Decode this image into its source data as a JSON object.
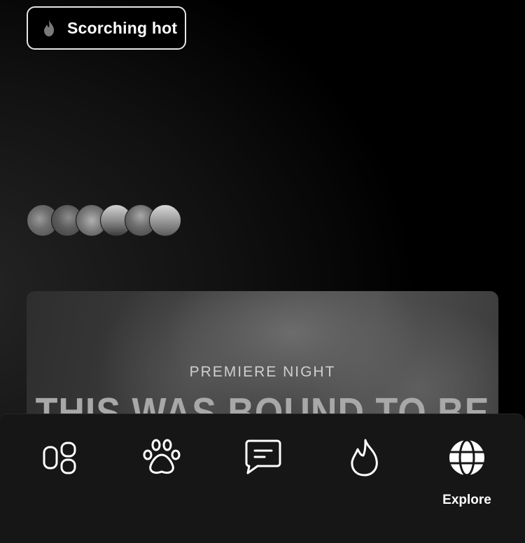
{
  "filter_chip": {
    "label": "Scorching hot",
    "icon": "flame-icon"
  },
  "avatars": [
    {
      "name": "avatar-1"
    },
    {
      "name": "avatar-2"
    },
    {
      "name": "avatar-3"
    },
    {
      "name": "avatar-4"
    },
    {
      "name": "avatar-5"
    },
    {
      "name": "avatar-6"
    }
  ],
  "promo": {
    "kicker": "PREMIERE NIGHT",
    "title": "THIS WAS BOUND TO BE"
  },
  "tabbar": {
    "items": [
      {
        "icon": "grid-icon",
        "label": ""
      },
      {
        "icon": "paw-icon",
        "label": ""
      },
      {
        "icon": "chat-icon",
        "label": ""
      },
      {
        "icon": "flame-icon",
        "label": ""
      },
      {
        "icon": "globe-icon",
        "label": "Explore",
        "active": true
      }
    ]
  },
  "colors": {
    "background": "#000000",
    "tabbar": "#161616",
    "text": "#ffffff"
  }
}
